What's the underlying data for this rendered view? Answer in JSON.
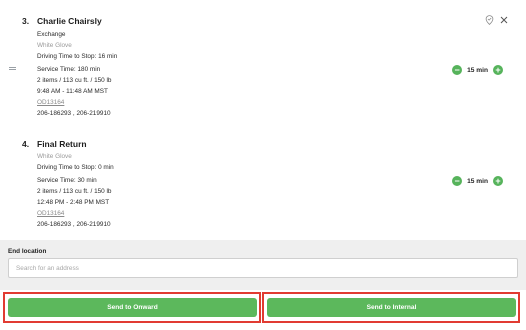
{
  "stops": [
    {
      "number": "3.",
      "name": "Charlie Chairsly",
      "type": "Exchange",
      "service_level": "White Glove",
      "driving_time": "Driving Time to Stop: 16 min",
      "service_time": "Service Time: 180 min",
      "items": "2 items / 113 cu ft. / 150 lb",
      "window": "9:48 AM - 11:48 AM MST",
      "order_id": "OD13164",
      "references": "206-186293 , 206-219910",
      "duration": "15 min"
    },
    {
      "number": "4.",
      "name": "Final Return",
      "service_level": "White Glove",
      "driving_time": "Driving Time to Stop: 0 min",
      "service_time": "Service Time: 30 min",
      "items": "2 items / 113 cu ft. / 150 lb",
      "window": "12:48 PM - 2:48 PM MST",
      "order_id": "OD13164",
      "references": "206-186293 , 206-219910",
      "duration": "15 min"
    }
  ],
  "icons": {
    "pin": "map-pin-icon",
    "close": "close-icon",
    "drag": "drag-handle-icon",
    "minus": "minus-icon",
    "plus": "plus-icon",
    "minus_symbol": "−",
    "plus_symbol": "+"
  },
  "end_location": {
    "label": "End location",
    "placeholder": "Search for an address",
    "value": ""
  },
  "actions": {
    "send_onward": "Send to Onward",
    "send_internal": "Send to Internal"
  },
  "colors": {
    "accent_green": "#5cb85c",
    "highlight_red": "#e13b32"
  }
}
